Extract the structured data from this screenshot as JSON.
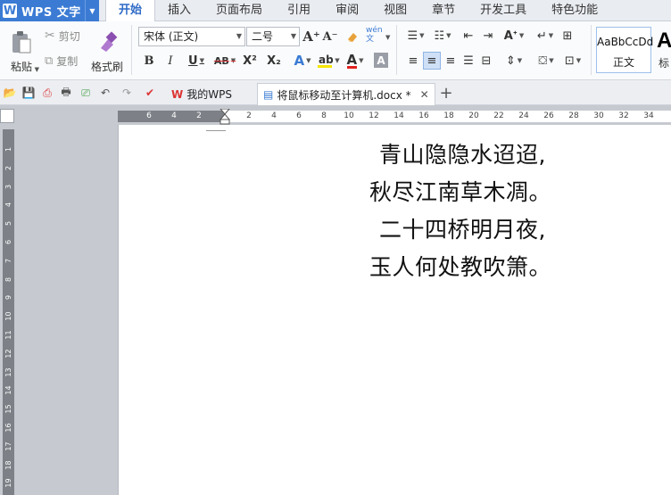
{
  "app": {
    "name": "WPS 文字",
    "logo_letter": "W"
  },
  "menu_tabs": [
    "开始",
    "插入",
    "页面布局",
    "引用",
    "审阅",
    "视图",
    "章节",
    "开发工具",
    "特色功能"
  ],
  "active_tab": "开始",
  "ribbon": {
    "paste_label": "粘贴",
    "cut_label": "剪切",
    "copy_label": "复制",
    "format_painter_label": "格式刷",
    "font_name": "宋体 (正文)",
    "font_size": "二号",
    "bold": "B",
    "italic": "I",
    "underline": "U",
    "strikethrough": "AB",
    "superscript": "X²",
    "subscript": "X₂",
    "font_color_letter": "A",
    "phonetic_label": "wén 文",
    "grow_font": "A⁺",
    "shrink_font": "A⁻",
    "style_sample": "AaBbCcDd",
    "style_label": "正文",
    "style_next_sample": "A",
    "style_next_label": "标"
  },
  "quickbar": {
    "tabs": [
      {
        "label": "我的WPS",
        "active": false
      },
      {
        "label": "将鼠标移动至计算机.docx *",
        "active": true
      }
    ],
    "new_tab": "+"
  },
  "hruler_ticks": [
    "6",
    "4",
    "2",
    "2",
    "4",
    "6",
    "8",
    "10",
    "12",
    "14",
    "16",
    "18",
    "20",
    "22",
    "24",
    "26",
    "28",
    "30",
    "32",
    "34"
  ],
  "vruler_ticks": [
    "1",
    "2",
    "3",
    "4",
    "5",
    "6",
    "7",
    "8",
    "9",
    "10",
    "11",
    "12",
    "13",
    "14",
    "15",
    "16",
    "17",
    "18",
    "19"
  ],
  "document": {
    "lines": [
      "青山隐隐水迢迢,",
      "秋尽江南草木凋。",
      "二十四桥明月夜,",
      "玉人何处教吹箫。"
    ]
  },
  "colors": {
    "accent": "#3b7bd4",
    "active_tab_text": "#2f6bc7",
    "ruler": "#7d8187"
  }
}
